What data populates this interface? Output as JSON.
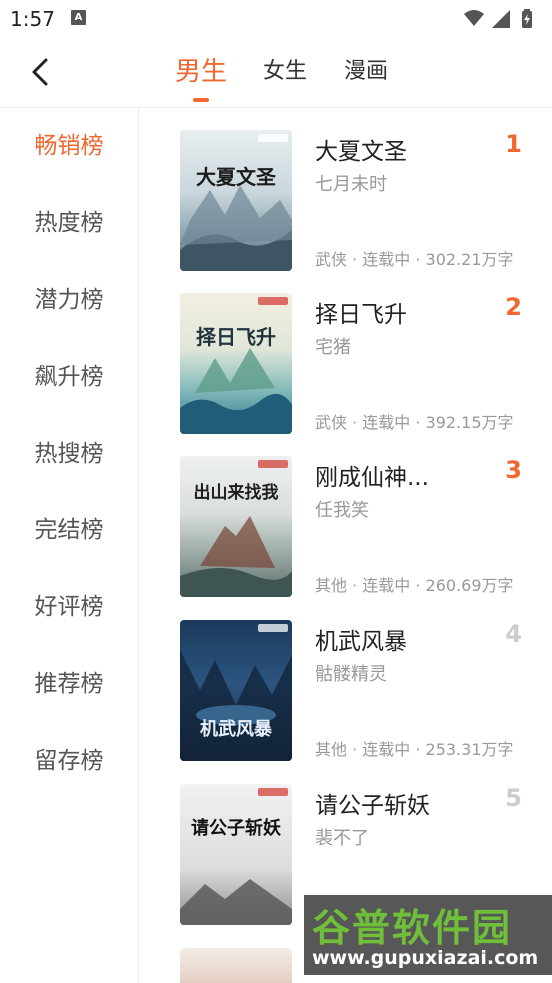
{
  "status_bar": {
    "time": "1:57",
    "notification_letter": "A"
  },
  "header": {
    "tabs": [
      {
        "label": "男生",
        "active": true
      },
      {
        "label": "女生",
        "active": false
      },
      {
        "label": "漫画",
        "active": false
      }
    ],
    "accent_color": "#f0672f"
  },
  "sidebar": {
    "items": [
      {
        "label": "畅销榜",
        "active": true
      },
      {
        "label": "热度榜"
      },
      {
        "label": "潜力榜"
      },
      {
        "label": "飙升榜"
      },
      {
        "label": "热搜榜"
      },
      {
        "label": "完结榜"
      },
      {
        "label": "好评榜"
      },
      {
        "label": "推荐榜"
      },
      {
        "label": "留存榜"
      }
    ]
  },
  "books": [
    {
      "rank": "1",
      "title": "大夏文圣",
      "author": "七月未时",
      "meta": "武侠 · 连载中 · 302.21万字",
      "cover_text": "大夏文圣",
      "rank_color": "#f0672f"
    },
    {
      "rank": "2",
      "title": "择日飞升",
      "author": "宅猪",
      "meta": "武侠 · 连载中 · 392.15万字",
      "cover_text": "择日飞升",
      "rank_color": "#f0672f"
    },
    {
      "rank": "3",
      "title": "刚成仙神...",
      "author": "任我笑",
      "meta": "其他 · 连载中 · 260.69万字",
      "cover_text": "出山来找我",
      "rank_color": "#f0672f"
    },
    {
      "rank": "4",
      "title": "机武风暴",
      "author": "骷髅精灵",
      "meta": "其他 · 连载中 · 253.31万字",
      "cover_text": "机武风暴",
      "rank_color": "#cccccc"
    },
    {
      "rank": "5",
      "title": "请公子斩妖",
      "author": "裴不了",
      "meta": "",
      "cover_text": "请公子斩妖",
      "rank_color": "#cccccc"
    }
  ],
  "watermark": {
    "text": "谷普软件园",
    "url": "www.gupuxiazai.com"
  }
}
